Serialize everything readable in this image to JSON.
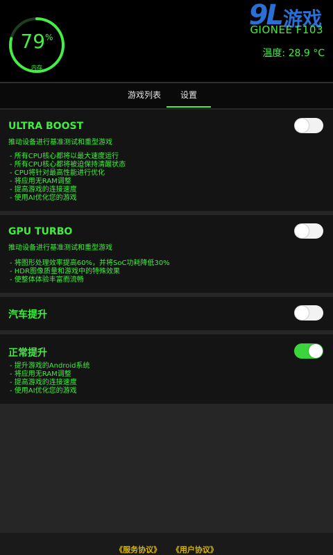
{
  "header": {
    "gauge": {
      "value": "79",
      "unit": "%",
      "label": "内存",
      "fraction": 0.79
    },
    "watermark": {
      "number": "9L",
      "text": "游戏"
    },
    "device_name": "GIONEE F103",
    "temperature": "温度: 28.9 °C"
  },
  "tabs": [
    {
      "label": "游戏列表",
      "active": false
    },
    {
      "label": "设置",
      "active": true
    }
  ],
  "settings": [
    {
      "title": "ULTRA BOOST",
      "subtitle": "推动设备进行基准测试和重型游戏",
      "items": [
        "- 所有CPU核心都将以最大速度运行",
        "- 所有CPU核心都将被迫保持清醒状态",
        "- CPU将针对最高性能进行优化",
        "- 将应用无RAM调整",
        "- 提高游戏的连接速度",
        "- 使用AI优化您的游戏"
      ],
      "enabled": false
    },
    {
      "title": "GPU TURBO",
      "subtitle": "推动设备进行基准测试和重型游戏",
      "items": [
        "- 将图形处理效率提高60%，并将SoC功耗降低30%",
        "- HDR图像质量和游戏中的特殊效果",
        "- 使整体体验丰富而流畅"
      ],
      "enabled": false
    },
    {
      "title": "汽车提升",
      "subtitle": "",
      "items": [],
      "enabled": false
    },
    {
      "title": "正常提升",
      "subtitle": "",
      "items": [
        "- 提升游戏的Android系统",
        "- 将应用无RAM调整",
        "- 提高游戏的连接速度",
        "- 使用AI优化您的游戏"
      ],
      "enabled": true
    }
  ],
  "footer": {
    "service_agreement": "《服务协议》",
    "user_agreement": "《用户协议》"
  },
  "colors": {
    "accent": "#3cf03c",
    "toggle_on": "#3cd43c",
    "footer_link": "#d6b600",
    "watermark": "#2a6fd6"
  }
}
